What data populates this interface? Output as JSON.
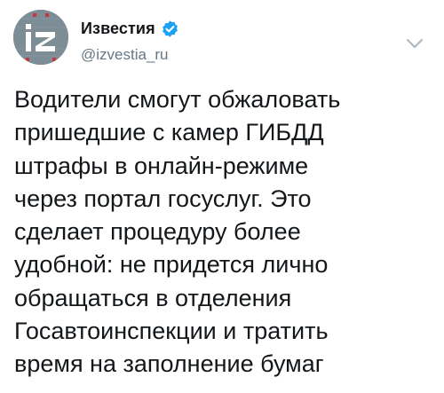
{
  "account": {
    "name": "Известия",
    "handle": "@izvestia_ru",
    "avatar_text": "iz",
    "verified_badge": "verified-badge-icon",
    "brand_color": "#7a8b93"
  },
  "menu": {
    "icon": "chevron-down-icon"
  },
  "tweet": {
    "text": "Водители смогут обжаловать\nпришедшие с камер ГИБДД\nштрафы в онлайн-режиме\nчерез портал госуслуг. Это\nсделает процедуру более\nудобной: не придется лично\nобращаться в отделения\nГосавтоинспекции и тратить\nвремя на заполнение бумаг"
  }
}
